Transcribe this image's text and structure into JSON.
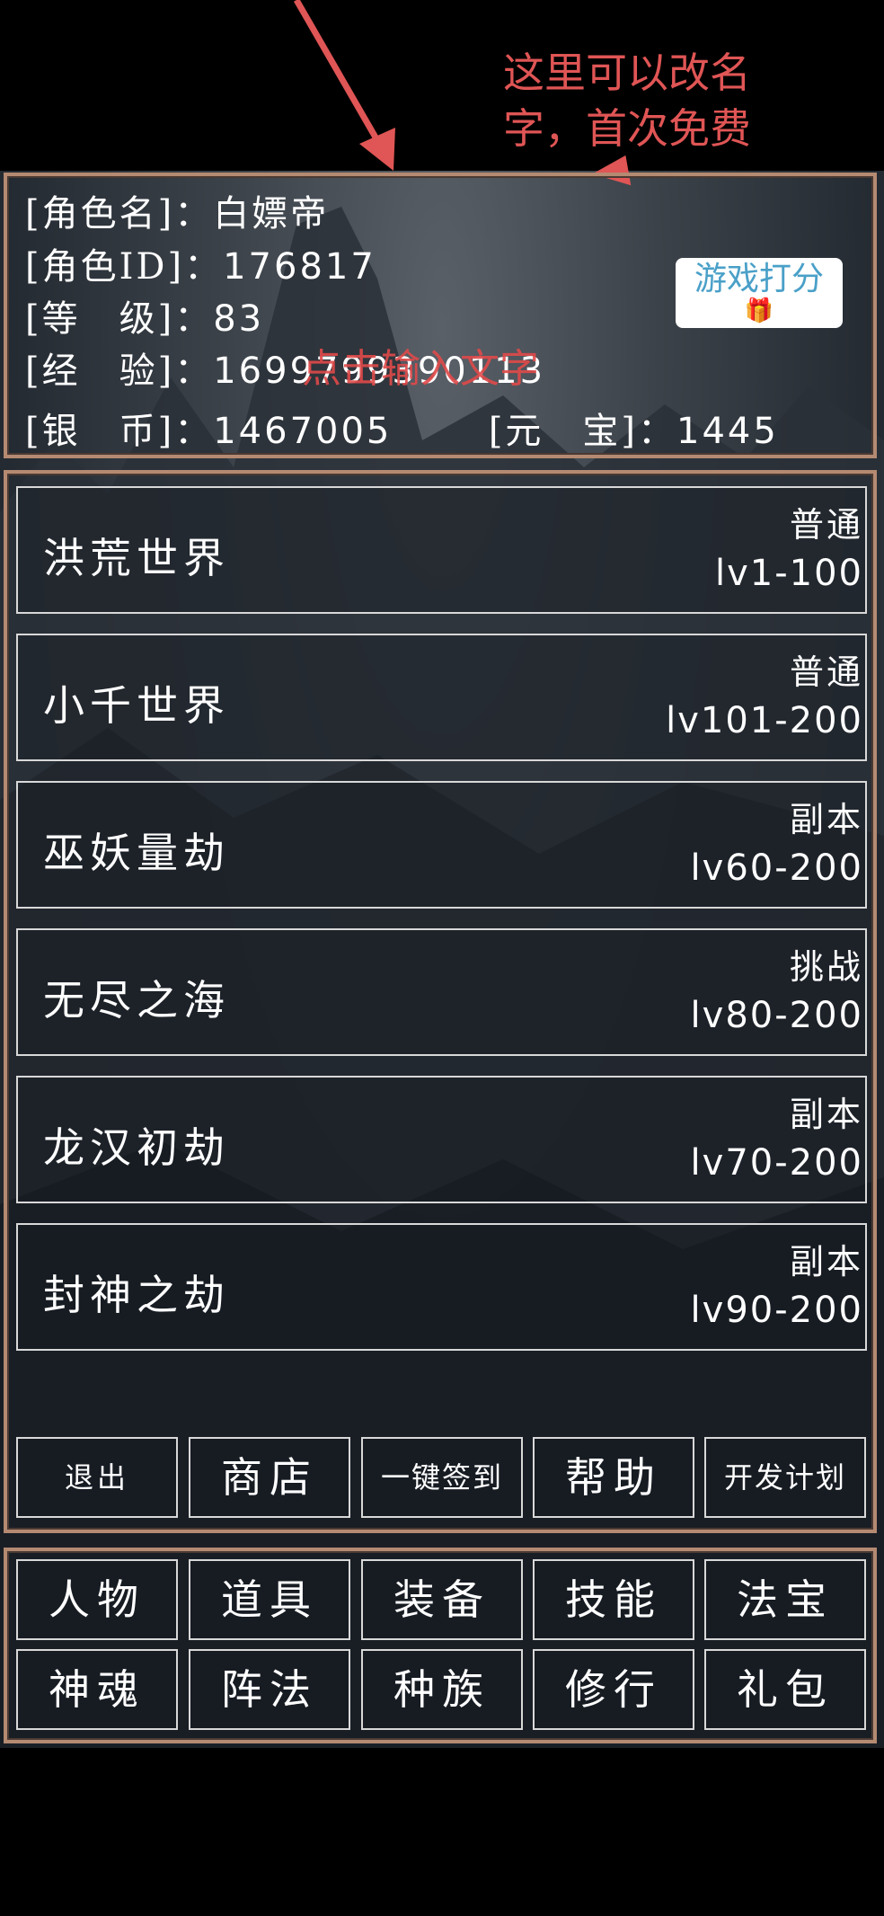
{
  "annotation": {
    "note_line1": "这里可以改名",
    "note_line2": "字，首次免费",
    "overlay": "点击输入文字"
  },
  "player": {
    "name_label": "[角色名]：",
    "name_value": "白嫖帝",
    "id_label": "[角色ID]：",
    "id_value": "176817",
    "level_label": "[等　级]：",
    "level_value": "83",
    "exp_label": "[经　验]：",
    "exp_value": "1699799390113",
    "silver_label": "[银　币]：",
    "silver_value": "1467005",
    "gold_label": "[元　宝]：",
    "gold_value": "1445"
  },
  "rate_button": {
    "label": "游戏打分",
    "icon": "gift-icon"
  },
  "worlds": [
    {
      "name": "洪荒世界",
      "kind": "普通",
      "level": "lv1-100"
    },
    {
      "name": "小千世界",
      "kind": "普通",
      "level": "lv101-200"
    },
    {
      "name": "巫妖量劫",
      "kind": "副本",
      "level": "lv60-200"
    },
    {
      "name": "无尽之海",
      "kind": "挑战",
      "level": "lv80-200"
    },
    {
      "name": "龙汉初劫",
      "kind": "副本",
      "level": "lv70-200"
    },
    {
      "name": "封神之劫",
      "kind": "副本",
      "level": "lv90-200"
    }
  ],
  "actions": {
    "exit": "退出",
    "shop": "商店",
    "checkin": "一键签到",
    "help": "帮助",
    "plan": "开发计划"
  },
  "nav": {
    "row1": [
      "人物",
      "道具",
      "装备",
      "技能",
      "法宝"
    ],
    "row2": [
      "神魂",
      "阵法",
      "种族",
      "修行",
      "礼包"
    ]
  },
  "colors": {
    "frame": "#b48a72",
    "annotation": "#e05555",
    "background": "#000000"
  }
}
